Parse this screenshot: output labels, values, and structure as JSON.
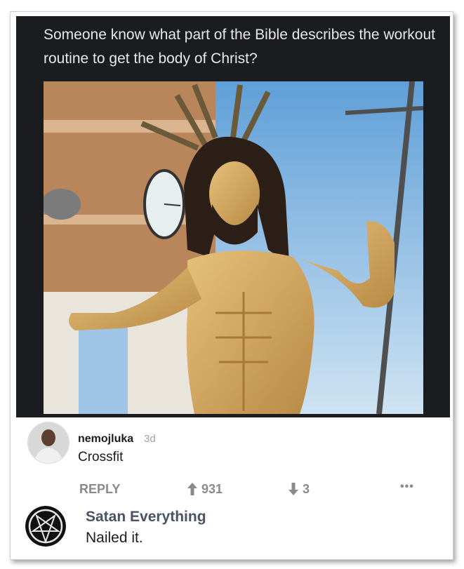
{
  "post": {
    "title": "Someone know what part of the Bible describes the workout routine to get the body of Christ?"
  },
  "comments": [
    {
      "username": "nemojluka",
      "age": "3d",
      "text": "Crossfit",
      "reply_label": "REPLY",
      "upvotes": "931",
      "downvotes": "3",
      "more": "•••"
    },
    {
      "username": "Satan Everything",
      "text": "Nailed it."
    }
  ],
  "colors": {
    "post_bg": "#1b1c20",
    "title_text": "#e8e8ea",
    "sky": "#7eb4e0",
    "action_gray": "#8a8a8a",
    "username2": "#4a5366"
  }
}
